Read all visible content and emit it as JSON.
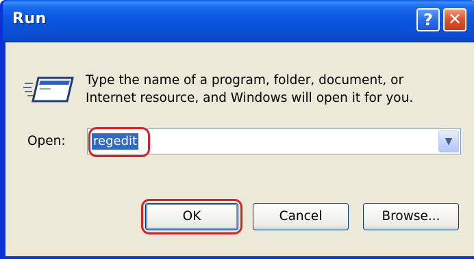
{
  "window": {
    "title": "Run",
    "help_label": "?",
    "close_label": "✕"
  },
  "dialog": {
    "icon": "run-program-icon",
    "description_line1": "Type the name of a program, folder, document, or",
    "description_line2": "Internet resource, and Windows will open it for you.",
    "open_label": "Open:",
    "open_value": "regedit",
    "dropdown_icon": "chevron-down-icon"
  },
  "buttons": {
    "ok_label": "OK",
    "cancel_label": "Cancel",
    "browse_label": "Browse..."
  },
  "colors": {
    "titlebar": "#0a57e0",
    "client_background": "#ece9d8",
    "selection": "#316ac5",
    "highlight_ring": "#d2232a"
  }
}
